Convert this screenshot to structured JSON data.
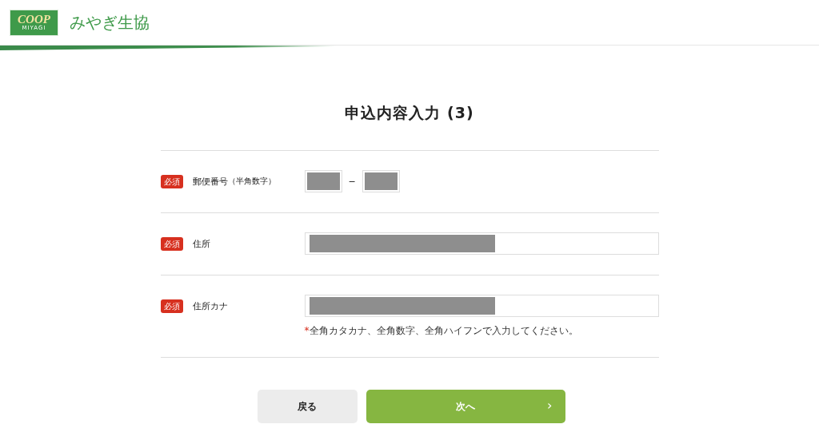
{
  "header": {
    "logo": {
      "mark": "COOP",
      "submark": "MIYAGI"
    },
    "site_name": "みやぎ生協"
  },
  "title": "申込内容入力 (3)",
  "fields": [
    {
      "kind": "postal",
      "badge": "必須",
      "label": "郵便番号",
      "label_note": "（半角数字）",
      "separator": "−",
      "inputs": [
        {
          "redacted": true
        },
        {
          "redacted": true
        }
      ]
    },
    {
      "kind": "text",
      "badge": "必須",
      "label": "住所",
      "inputs": [
        {
          "redacted": true
        }
      ]
    },
    {
      "kind": "text",
      "badge": "必須",
      "label": "住所カナ",
      "inputs": [
        {
          "redacted": true
        }
      ],
      "note_mark": "*",
      "note": "全角カタカナ、全角数字、全角ハイフンで入力してください。"
    }
  ],
  "buttons": [
    {
      "kind": "back",
      "label": "戻る"
    },
    {
      "kind": "next",
      "label": "次へ",
      "icon": "›"
    }
  ]
}
